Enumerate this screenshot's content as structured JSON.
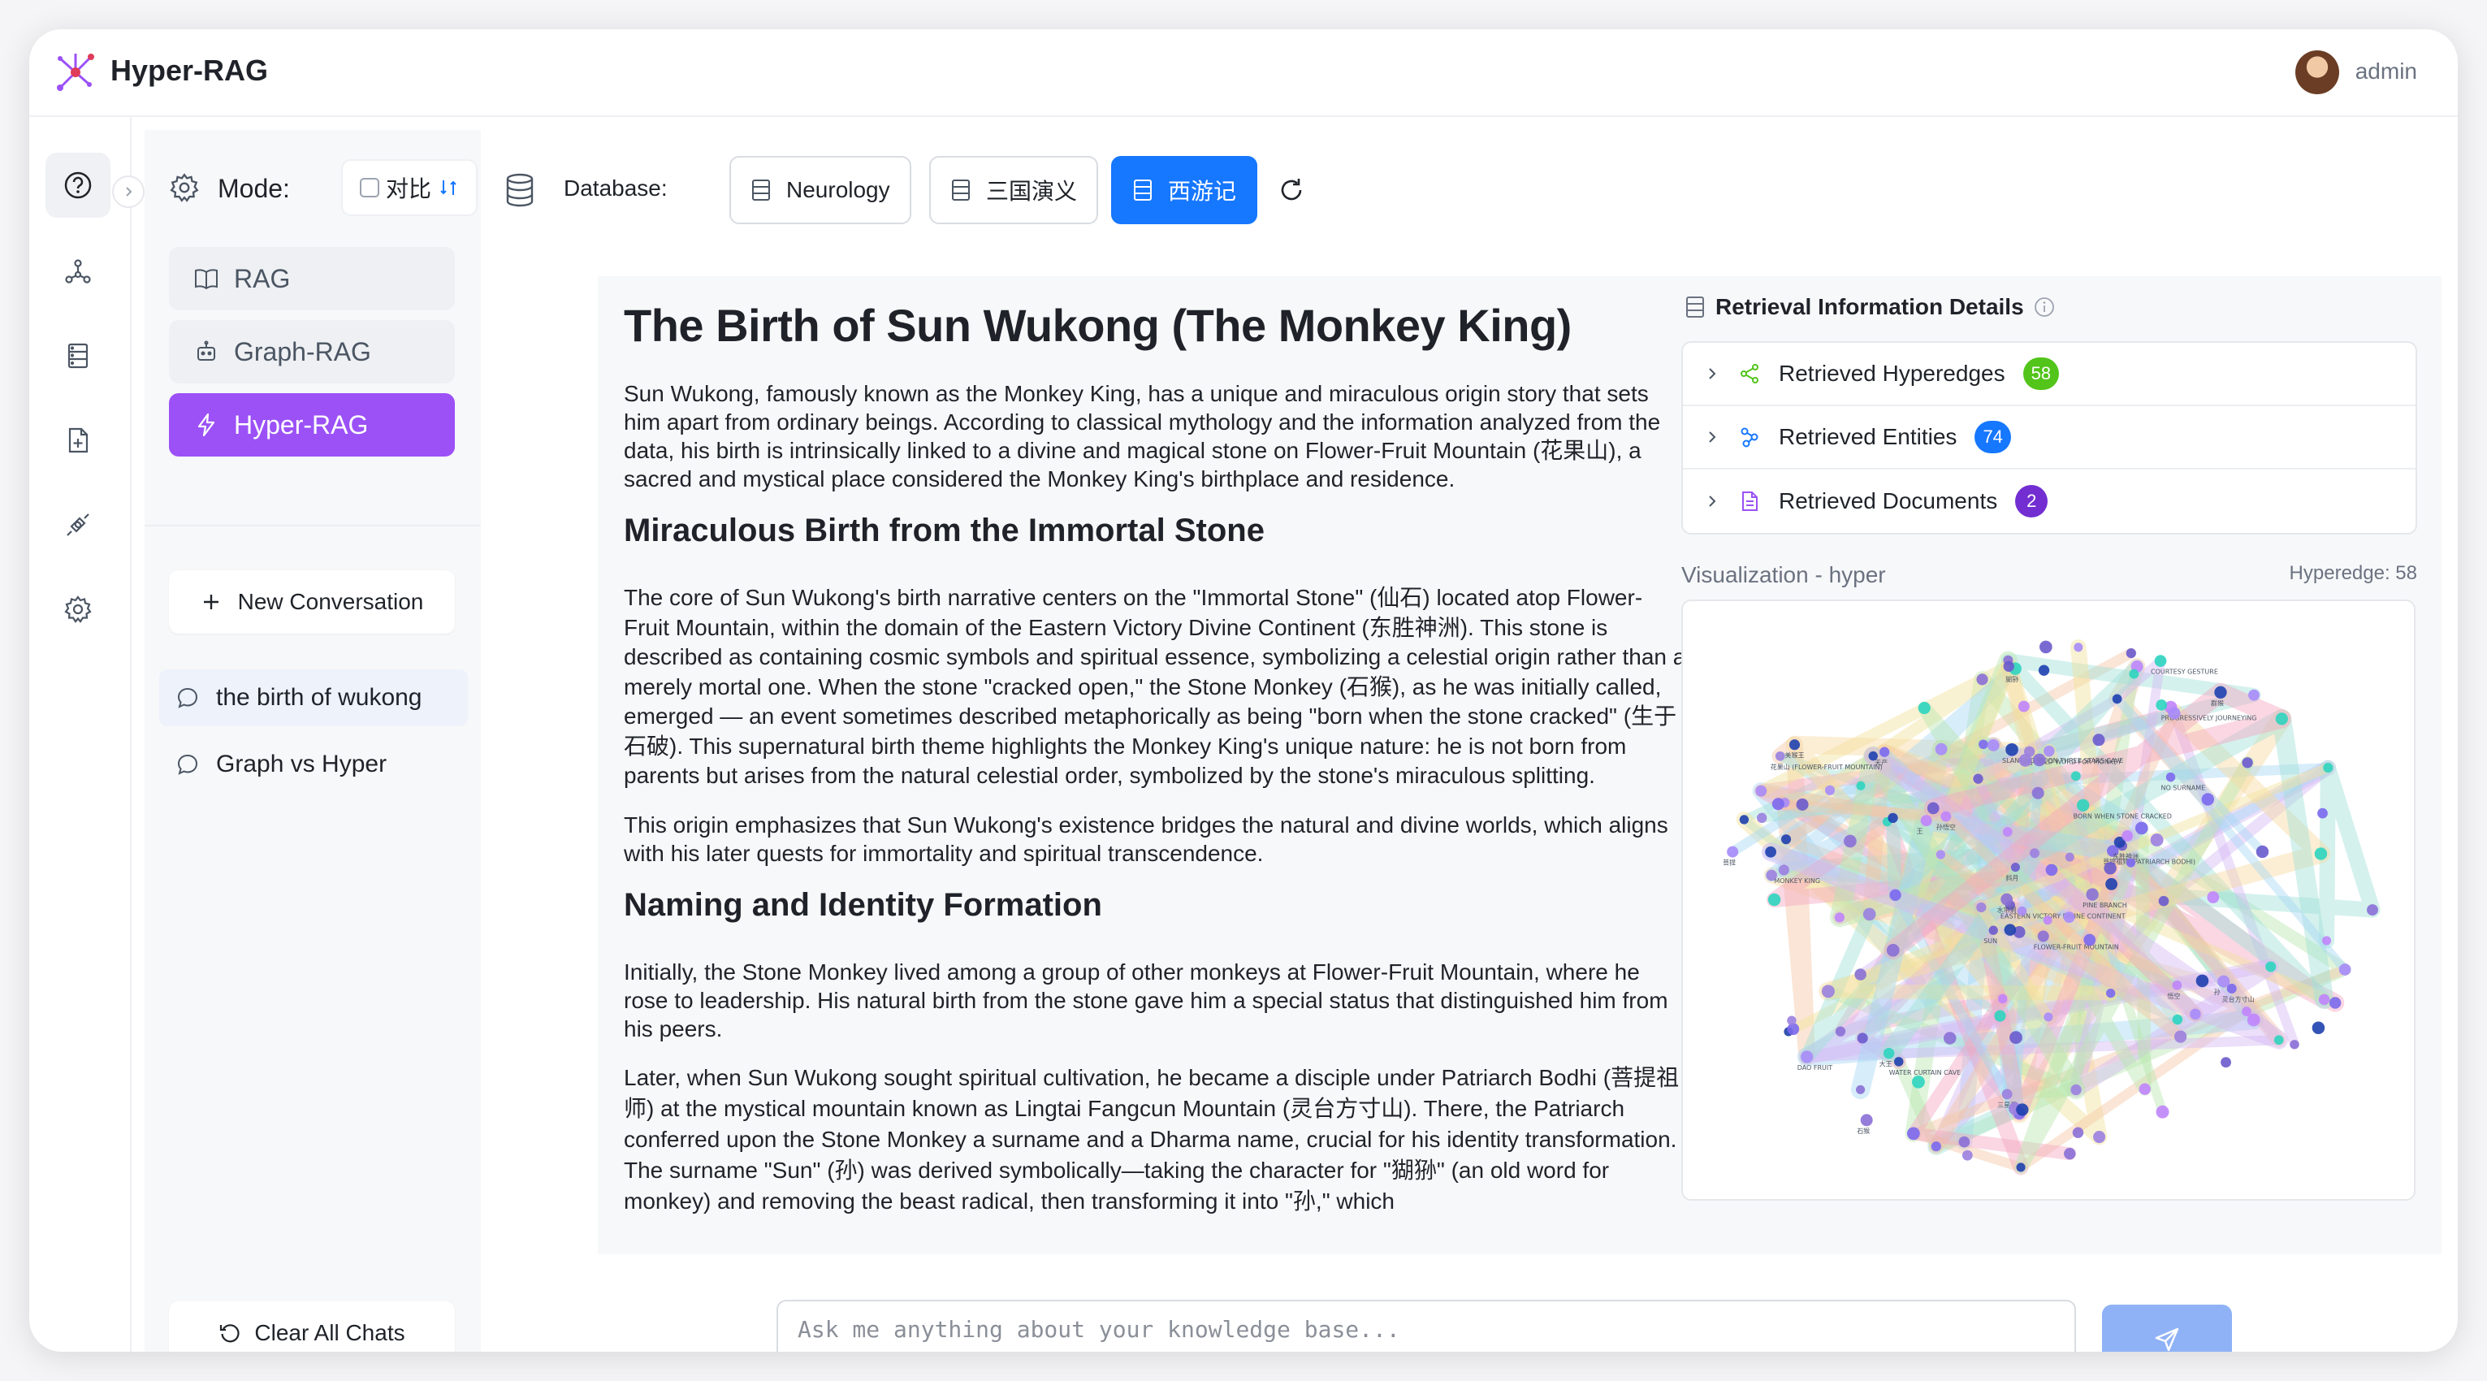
{
  "app": {
    "title": "Hyper-RAG",
    "user": "admin"
  },
  "rail": {
    "items": [
      "help-icon",
      "graph-icon",
      "database-icon",
      "file-add-icon",
      "api-icon",
      "settings-icon"
    ]
  },
  "sidebar": {
    "mode_label": "Mode:",
    "compare_label": "对比",
    "modes": [
      "RAG",
      "Graph-RAG",
      "Hyper-RAG"
    ],
    "active_mode": "Hyper-RAG",
    "new_conversation": "New Conversation",
    "conversations": [
      "the birth of wukong",
      "Graph vs Hyper"
    ],
    "clear_all": "Clear All Chats"
  },
  "toolbar": {
    "database_label": "Database:",
    "databases": [
      "Neurology",
      "三国演义",
      "西游记"
    ],
    "active_database": "西游记"
  },
  "article": {
    "title": "The Birth of Sun Wukong (The Monkey King)",
    "p1": "Sun Wukong, famously known as the Monkey King, has a unique and miraculous origin story that sets him apart from ordinary beings. According to classical mythology and the information analyzed from the data, his birth is intrinsically linked to a divine and magical stone on Flower-Fruit Mountain (花果山), a sacred and mystical place considered the Monkey King's birthplace and residence.",
    "h2_1": "Miraculous Birth from the Immortal Stone",
    "p2": "The core of Sun Wukong's birth narrative centers on the \"Immortal Stone\" (仙石) located atop Flower-Fruit Mountain, within the domain of the Eastern Victory Divine Continent (东胜神洲). This stone is described as containing cosmic symbols and spiritual essence, symbolizing a celestial origin rather than a merely mortal one. When the stone \"cracked open,\" the Stone Monkey (石猴), as he was initially called, emerged — an event sometimes described metaphorically as being \"born when the stone cracked\" (生于石破). This supernatural birth theme highlights the Monkey King's unique nature: he is not born from parents but arises from the natural celestial order, symbolized by the stone's miraculous splitting.",
    "p3": "This origin emphasizes that Sun Wukong's existence bridges the natural and divine worlds, which aligns with his later quests for immortality and spiritual transcendence.",
    "h2_2": "Naming and Identity Formation",
    "p4": "Initially, the Stone Monkey lived among a group of other monkeys at Flower-Fruit Mountain, where he rose to leadership. His natural birth from the stone gave him a special status that distinguished him from his peers.",
    "p5": "Later, when Sun Wukong sought spiritual cultivation, he became a disciple under Patriarch Bodhi (菩提祖师) at the mystical mountain known as Lingtai Fangcun Mountain (灵台方寸山). There, the Patriarch conferred upon the Stone Monkey a surname and a Dharma name, crucial for his identity transformation. The surname \"Sun\" (孙) was derived symbolically—taking the character for \"猢狲\" (an old word for monkey) and removing the beast radical, then transforming it into \"孙,\" which"
  },
  "details": {
    "title": "Retrieval Information Details",
    "rows": [
      {
        "label": "Retrieved Hyperedges",
        "count": "58",
        "color": "#52c41a"
      },
      {
        "label": "Retrieved Entities",
        "count": "74",
        "color": "#1677ff"
      },
      {
        "label": "Retrieved Documents",
        "count": "2",
        "color": "#722ed1"
      }
    ],
    "viz_title": "Visualization - hyper",
    "viz_count": "Hyperedge: 58",
    "node_labels": [
      "FLOWER-FRUIT MOUNTAIN",
      "花果山 (FLOWER-FRUIT MOUNTAIN)",
      "EASTERN VICTORY DIVINE CONTINENT",
      "菩提祖师 (PATRIARCH BODHI)",
      "WATER CURTAIN CAVE",
      "COURTESY GESTURE",
      "OLD WORD FOR MONKEY",
      "PROGRESSIVELY JOURNEYING",
      "PINE BRANCH",
      "MONKEY KING",
      "SUN",
      "NO SURNAME",
      "SLANTING MOON THREE STARS CAVE",
      "BORN WHEN STONE CRACKED",
      "DAO FRUIT",
      "孙悟空",
      "石猴",
      "仙石",
      "东胜神洲",
      "灵台方寸山",
      "美猴王",
      "猢狲",
      "菩提",
      "悟空",
      "水帘洞",
      "三星洞",
      "斜月",
      "天产",
      "群猴",
      "大王",
      "孙",
      "王"
    ]
  },
  "input": {
    "placeholder": "Ask me anything about your knowledge base..."
  }
}
